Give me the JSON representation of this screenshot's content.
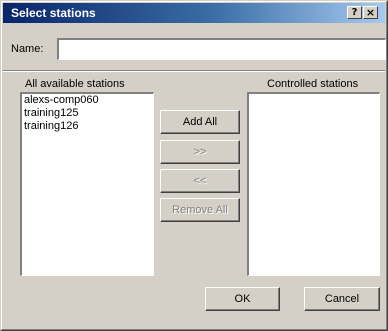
{
  "window": {
    "title": "Select stations",
    "help_glyph": "?",
    "close_glyph": "×"
  },
  "name_field": {
    "label": "Name:",
    "value": "",
    "placeholder": ""
  },
  "available": {
    "label": "All available stations",
    "items": [
      "alexs-comp060",
      "training125",
      "training126"
    ]
  },
  "controlled": {
    "label": "Controlled stations",
    "items": []
  },
  "buttons": {
    "add_all": "Add All",
    "add": ">>",
    "remove": "<<",
    "remove_all": "Remove All",
    "ok": "OK",
    "cancel": "Cancel"
  },
  "colors": {
    "face": "#d4d0c8",
    "title_start": "#0a246a",
    "title_end": "#a6caf0",
    "disabled_text": "#808080"
  }
}
